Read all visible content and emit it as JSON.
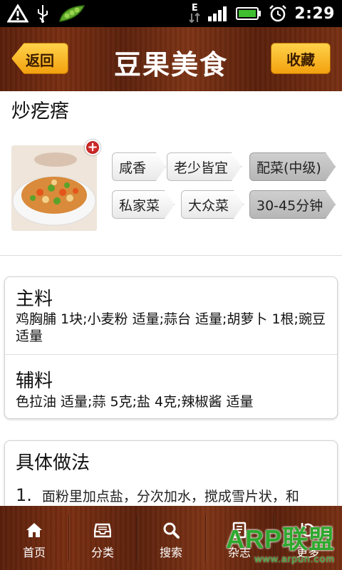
{
  "status_bar": {
    "time": "2:29",
    "network_label": "E",
    "icons": [
      "warning-icon",
      "usb-icon",
      "pea-app-icon",
      "data-arrows-icon",
      "signal-icon",
      "battery-icon",
      "alarm-icon"
    ]
  },
  "header": {
    "back_label": "返回",
    "title": "豆果美食",
    "favorite_label": "收藏"
  },
  "dish": {
    "name": "炒疙瘩",
    "add_badge": "+",
    "tags": [
      "咸香",
      "老少皆宜",
      "配菜(中级)",
      "私家菜",
      "大众菜",
      "30-45分钟"
    ]
  },
  "ingredients": {
    "main_title": "主料",
    "main_text": "鸡胸脯 1块;小麦粉 适量;蒜台 适量;胡萝卜 1根;豌豆 适量",
    "aux_title": "辅料",
    "aux_text": "色拉油 适量;蒜 5克;盐 4克;辣椒酱 适量"
  },
  "method": {
    "title": "具体做法",
    "step_number": "1.",
    "step_text": "面粉里加点盐，分次加水，搅成雪片状，和"
  },
  "bottom_nav": {
    "items": [
      {
        "label": "首页",
        "icon": "home-icon"
      },
      {
        "label": "分类",
        "icon": "tray-icon"
      },
      {
        "label": "搜索",
        "icon": "search-icon"
      },
      {
        "label": "杂志",
        "icon": "magazine-icon"
      },
      {
        "label": "更多",
        "icon": "more-icon"
      }
    ]
  },
  "watermark": {
    "main": "ARP联盟",
    "sub": "www.arpun.com"
  },
  "colors": {
    "wood_brown": "#6a2810",
    "button_gold": "#f7b21a",
    "tag_grey": "#c4c4c4",
    "watermark_green": "#2ea82e"
  }
}
